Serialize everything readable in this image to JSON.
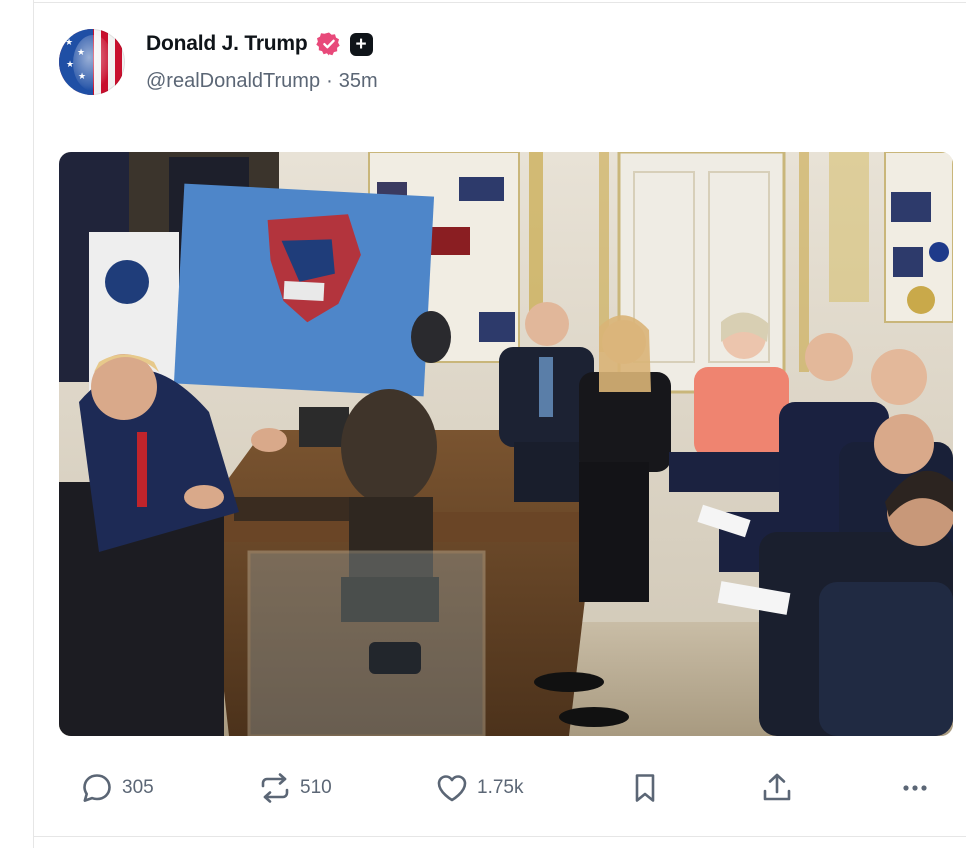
{
  "post": {
    "author": {
      "display_name": "Donald J. Trump",
      "handle": "@realDonaldTrump",
      "separator": "·",
      "time_ago": "35m",
      "verified_icon": "verified-badge-icon",
      "badge_icon": "plus-badge-icon"
    },
    "media": {
      "kind": "photo"
    },
    "actions": {
      "reply_count": "305",
      "repost_count": "510",
      "like_count": "1.75k",
      "reply_icon": "reply-icon",
      "repost_icon": "repost-icon",
      "like_icon": "heart-icon",
      "bookmark_icon": "bookmark-icon",
      "share_icon": "share-icon",
      "more_icon": "more-icon"
    }
  },
  "colors": {
    "text_primary": "#0f1419",
    "text_secondary": "#5b6675",
    "verified_pink": "#e8497a",
    "divider": "#e6e6e6"
  }
}
